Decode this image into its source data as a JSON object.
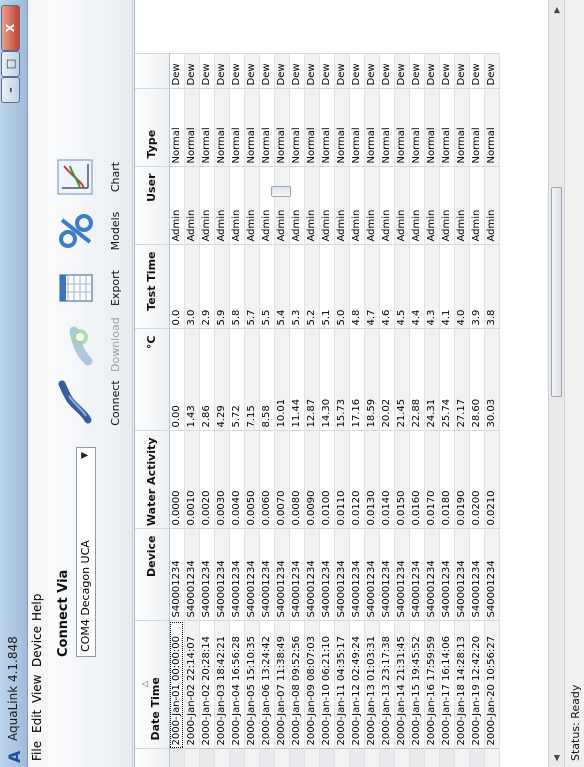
{
  "window": {
    "title": "AquaLink 4.1.848",
    "min_label": "–",
    "max_label": "□",
    "close_label": "X"
  },
  "menu": [
    "File",
    "Edit",
    "View",
    "Device",
    "Help"
  ],
  "connect": {
    "title": "Connect Via",
    "selected_port": "COM4 Decagon UCA"
  },
  "toolbar": {
    "connect": "Connect",
    "download": "Download",
    "export": "Export",
    "models": "Models",
    "chart": "Chart"
  },
  "table": {
    "columns": [
      "Date Time",
      "Device",
      "Water Activity",
      "°C",
      "Test Time",
      "User",
      "Type",
      ""
    ],
    "rows": [
      [
        "2000-Jan-01 00:00:00",
        "S40001234",
        "0.0000",
        "0.00",
        "0.0",
        "Admin",
        "Normal",
        "Dew"
      ],
      [
        "2000-Jan-02 22:14:07",
        "S40001234",
        "0.0010",
        "1.43",
        "3.0",
        "Admin",
        "Normal",
        "Dew"
      ],
      [
        "2000-Jan-02 20:28:14",
        "S40001234",
        "0.0020",
        "2.86",
        "2.9",
        "Admin",
        "Normal",
        "Dew"
      ],
      [
        "2000-Jan-03 18:42:21",
        "S40001234",
        "0.0030",
        "4.29",
        "5.9",
        "Admin",
        "Normal",
        "Dew"
      ],
      [
        "2000-Jan-04 16:56:28",
        "S40001234",
        "0.0040",
        "5.72",
        "5.8",
        "Admin",
        "Normal",
        "Dew"
      ],
      [
        "2000-Jan-05 15:10:35",
        "S40001234",
        "0.0050",
        "7.15",
        "5.7",
        "Admin",
        "Normal",
        "Dew"
      ],
      [
        "2000-Jan-06 13:24:42",
        "S40001234",
        "0.0060",
        "8.58",
        "5.5",
        "Admin",
        "Normal",
        "Dew"
      ],
      [
        "2000-Jan-07 11:38:49",
        "S40001234",
        "0.0070",
        "10.01",
        "5.4",
        "Admin",
        "Normal",
        "Dew"
      ],
      [
        "2000-Jan-08 09:52:56",
        "S40001234",
        "0.0080",
        "11.44",
        "5.3",
        "Admin",
        "Normal",
        "Dew"
      ],
      [
        "2000-Jan-09 08:07:03",
        "S40001234",
        "0.0090",
        "12.87",
        "5.2",
        "Admin",
        "Normal",
        "Dew"
      ],
      [
        "2000-Jan-10 06:21:10",
        "S40001234",
        "0.0100",
        "14.30",
        "5.1",
        "Admin",
        "Normal",
        "Dew"
      ],
      [
        "2000-Jan-11 04:35:17",
        "S40001234",
        "0.0110",
        "15.73",
        "5.0",
        "Admin",
        "Normal",
        "Dew"
      ],
      [
        "2000-Jan-12 02:49:24",
        "S40001234",
        "0.0120",
        "17.16",
        "4.8",
        "Admin",
        "Normal",
        "Dew"
      ],
      [
        "2000-Jan-13 01:03:31",
        "S40001234",
        "0.0130",
        "18.59",
        "4.7",
        "Admin",
        "Normal",
        "Dew"
      ],
      [
        "2000-Jan-13 23:17:38",
        "S40001234",
        "0.0140",
        "20.02",
        "4.6",
        "Admin",
        "Normal",
        "Dew"
      ],
      [
        "2000-Jan-14 21:31:45",
        "S40001234",
        "0.0150",
        "21.45",
        "4.5",
        "Admin",
        "Normal",
        "Dew"
      ],
      [
        "2000-Jan-15 19:45:52",
        "S40001234",
        "0.0160",
        "22.88",
        "4.4",
        "Admin",
        "Normal",
        "Dew"
      ],
      [
        "2000-Jan-16 17:59:59",
        "S40001234",
        "0.0170",
        "24.31",
        "4.3",
        "Admin",
        "Normal",
        "Dew"
      ],
      [
        "2000-Jan-17 16:14:06",
        "S40001234",
        "0.0180",
        "25.74",
        "4.1",
        "Admin",
        "Normal",
        "Dew"
      ],
      [
        "2000-Jan-18 14:28:13",
        "S40001234",
        "0.0190",
        "27.17",
        "4.0",
        "Admin",
        "Normal",
        "Dew"
      ],
      [
        "2000-Jan-19 12:42:20",
        "S40001234",
        "0.0200",
        "28.60",
        "3.9",
        "Admin",
        "Normal",
        "Dew"
      ],
      [
        "2000-Jan-20 10:56:27",
        "S40001234",
        "0.0210",
        "30.03",
        "3.8",
        "Admin",
        "Normal",
        "Dew"
      ]
    ]
  },
  "status": "Status: Ready",
  "colors": {
    "title_bar": "#bcd4ec",
    "close_button": "#c0412d",
    "alt_row": "#f2f2f2"
  }
}
